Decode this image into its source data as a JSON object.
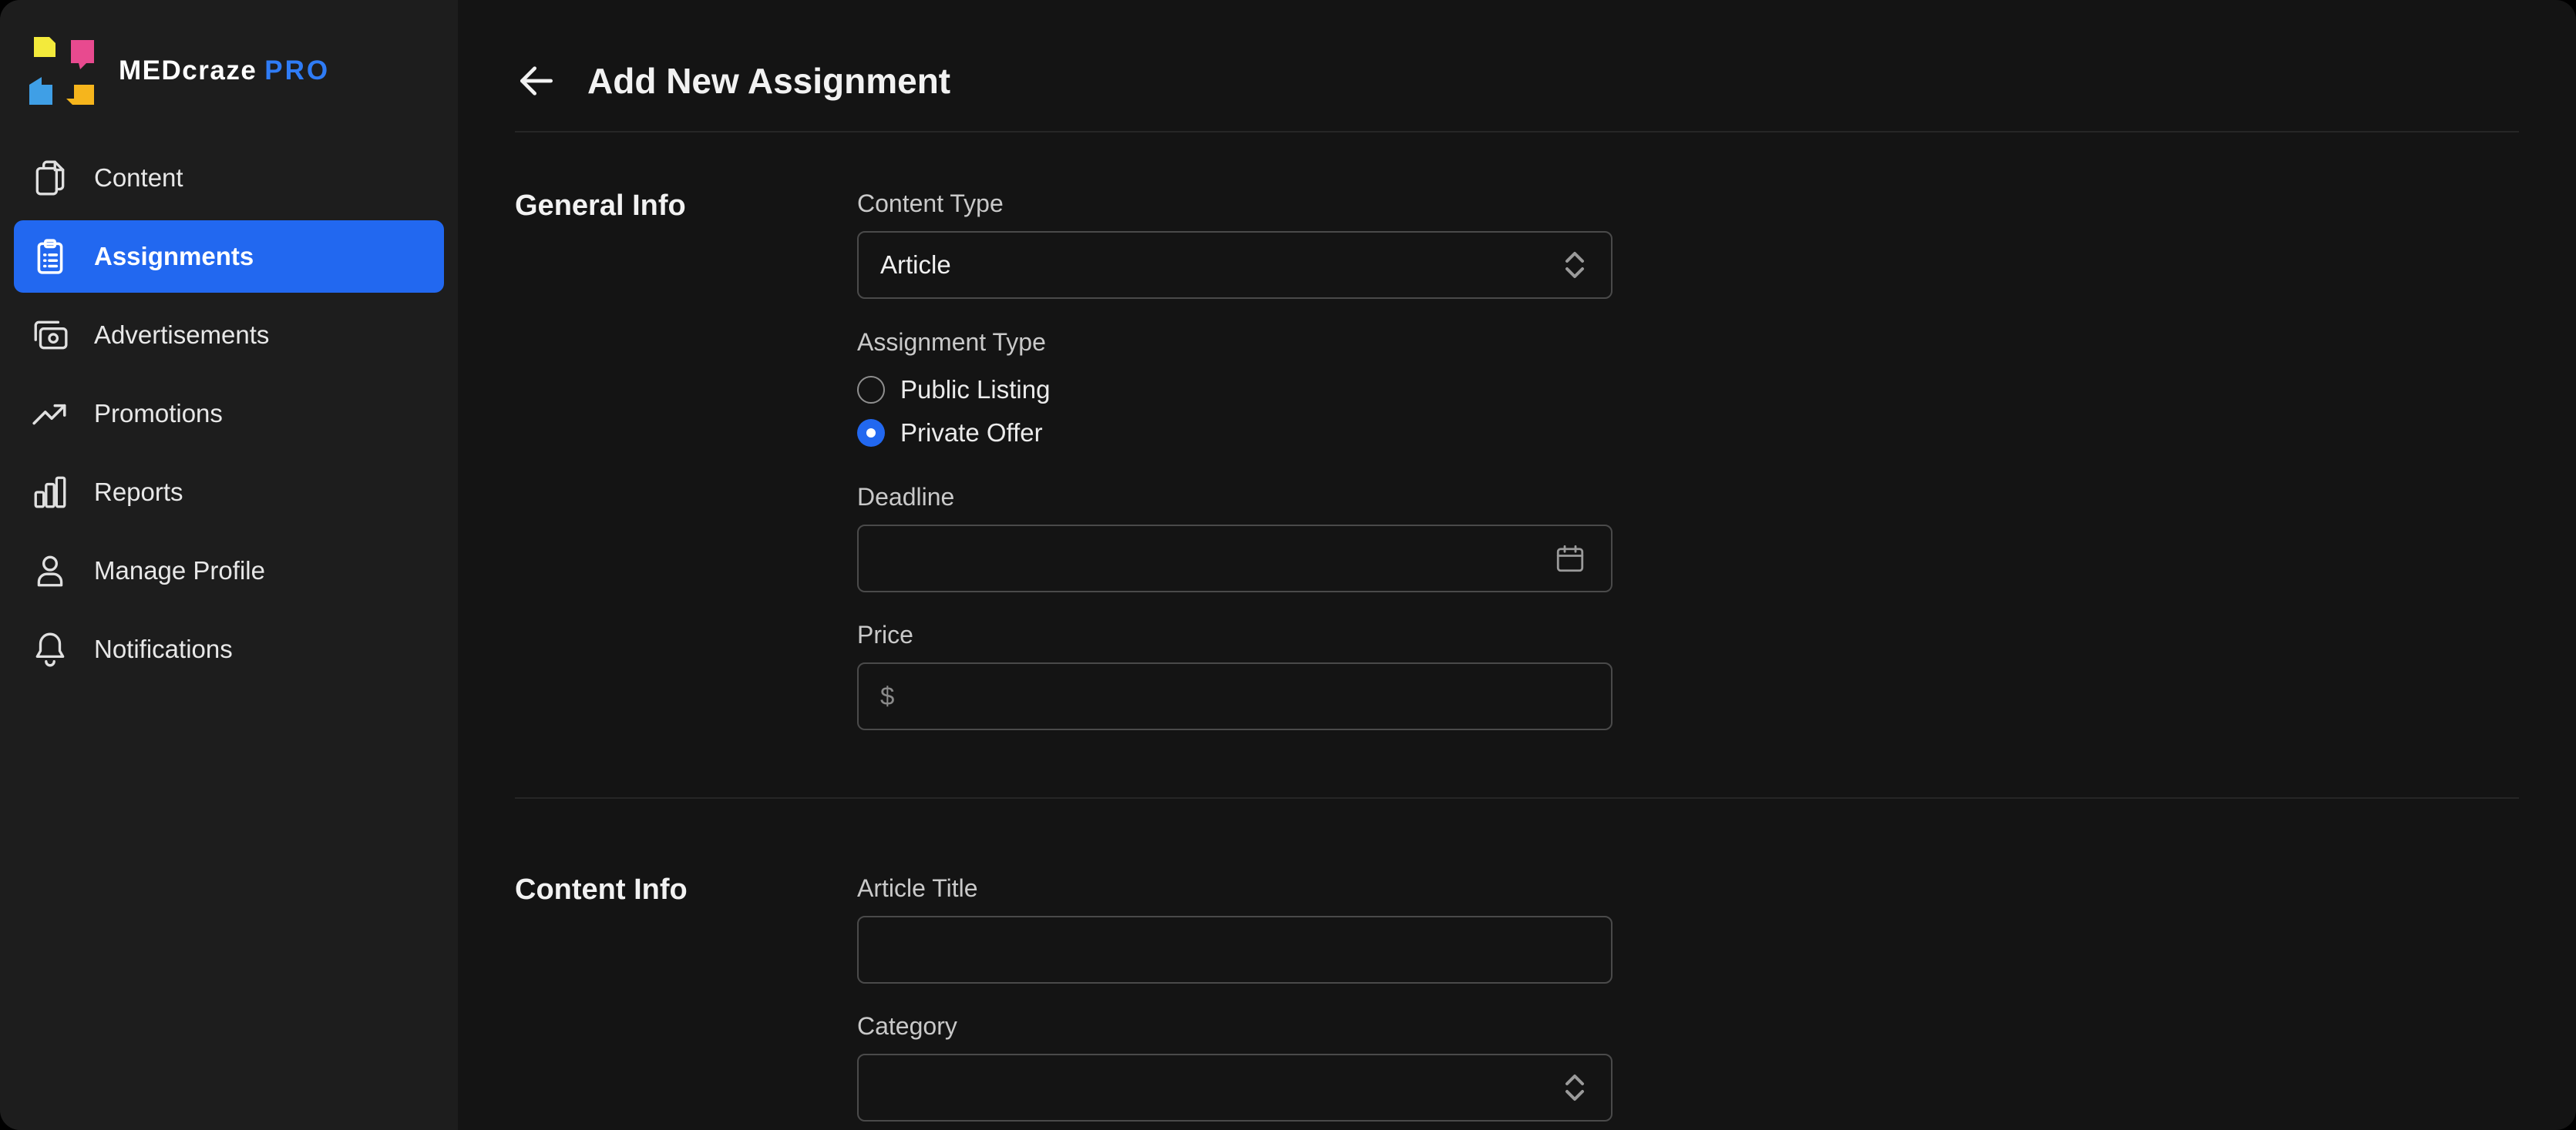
{
  "brand": {
    "name": "MEDcraze",
    "tier": "PRO"
  },
  "sidebar": {
    "items": [
      {
        "label": "Content",
        "icon": "documents-icon",
        "active": false
      },
      {
        "label": "Assignments",
        "icon": "clipboard-list-icon",
        "active": true
      },
      {
        "label": "Advertisements",
        "icon": "cash-icon",
        "active": false
      },
      {
        "label": "Promotions",
        "icon": "trending-up-icon",
        "active": false
      },
      {
        "label": "Reports",
        "icon": "bar-chart-icon",
        "active": false
      },
      {
        "label": "Manage Profile",
        "icon": "user-icon",
        "active": false
      },
      {
        "label": "Notifications",
        "icon": "bell-icon",
        "active": false
      }
    ]
  },
  "header": {
    "title": "Add New Assignment",
    "back_icon": "arrow-left-icon"
  },
  "general_info": {
    "section_title": "General Info",
    "content_type": {
      "label": "Content Type",
      "value": "Article",
      "icon": "chevron-up-down-icon"
    },
    "assignment_type": {
      "label": "Assignment Type",
      "options": [
        {
          "label": "Public Listing",
          "checked": false
        },
        {
          "label": "Private Offer",
          "checked": true
        }
      ]
    },
    "deadline": {
      "label": "Deadline",
      "value": "",
      "icon": "calendar-icon"
    },
    "price": {
      "label": "Price",
      "prefix": "$",
      "value": ""
    }
  },
  "content_info": {
    "section_title": "Content Info",
    "article_title": {
      "label": "Article Title",
      "value": ""
    },
    "category": {
      "label": "Category",
      "value": "",
      "icon": "chevron-up-down-icon"
    }
  },
  "colors": {
    "accent": "#2268f0",
    "brand_pro": "#2f7cf6",
    "sidebar_bg": "#1d1d1d",
    "main_bg": "#141414"
  }
}
